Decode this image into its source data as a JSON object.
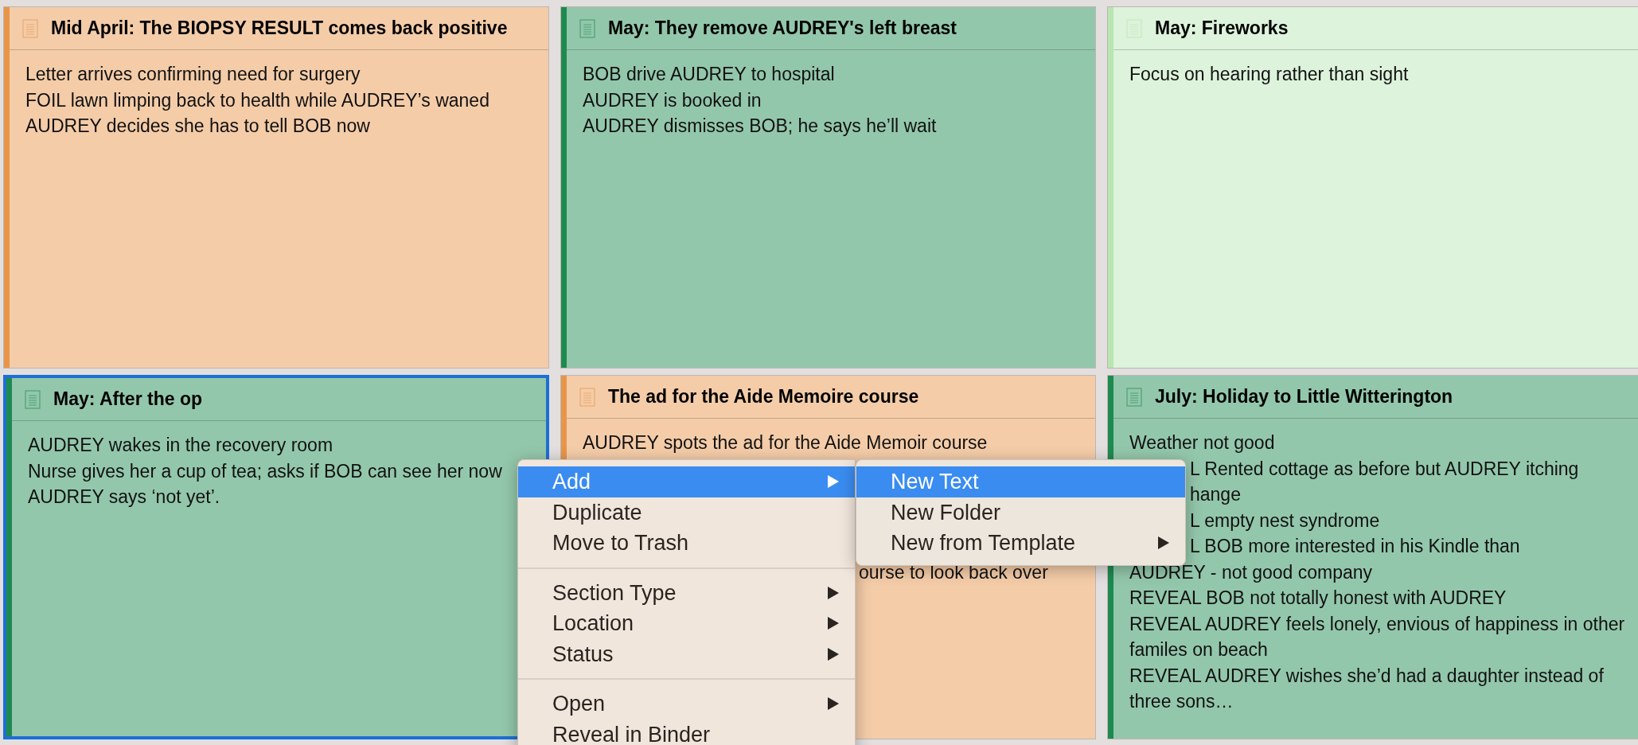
{
  "cards": [
    {
      "title": "Mid April: The BIOPSY RESULT comes back positive",
      "color": "#e8954a",
      "selected": false,
      "lines": [
        {
          "text": "Letter arrives confirming need for surgery",
          "kind": "full"
        },
        {
          "text": "FOIL lawn limping back to health while AUDREY’s waned",
          "kind": "full"
        },
        {
          "text": "AUDREY decides she has to tell BOB now",
          "kind": "full"
        }
      ]
    },
    {
      "title": "May: They remove AUDREY's left breast",
      "color": "#1e8a50",
      "selected": false,
      "lines": [
        {
          "text": "BOB drive AUDREY to hospital",
          "kind": "full"
        },
        {
          "text": "AUDREY is booked in",
          "kind": "full"
        },
        {
          "text": "AUDREY dismisses BOB; he says he’ll wait",
          "kind": "full"
        }
      ]
    },
    {
      "title": "May: Fireworks",
      "color": "#b9e5b3",
      "selected": false,
      "lines": [
        {
          "text": "Focus on hearing rather than sight",
          "kind": "full"
        }
      ]
    },
    {
      "title": "May: After the op",
      "color": "#1e8a50",
      "selected": true,
      "lines": [
        {
          "text": "AUDREY wakes in the recovery room",
          "kind": "full"
        },
        {
          "text": "Nurse gives her a cup of tea; asks if BOB can see her now",
          "kind": "full"
        },
        {
          "text": "AUDREY says ‘not yet’.",
          "kind": "full"
        }
      ]
    },
    {
      "title": "The ad for the Aide Memoire course",
      "color": "#e8954a",
      "selected": false,
      "lines": [
        {
          "text": "AUDREY spots the ad for the Aide Memoir course",
          "kind": "full"
        },
        {
          "text": "ourse to look back over",
          "kind": "behind_menu"
        }
      ]
    },
    {
      "title": "July: Holiday to Little Witterington",
      "color": "#1e8a50",
      "selected": false,
      "lines": [
        {
          "text": "Weather not good",
          "kind": "full"
        },
        {
          "text": "L Rented cottage as before but AUDREY itching",
          "kind": "behind_submenu"
        },
        {
          "text": "hange",
          "kind": "behind_submenu"
        },
        {
          "text": "L empty nest syndrome",
          "kind": "behind_submenu"
        },
        {
          "text": "L BOB more interested in his Kindle than",
          "kind": "behind_submenu"
        },
        {
          "text": "AUDREY - not good company",
          "kind": "full"
        },
        {
          "text": "REVEAL BOB not totally honest with AUDREY",
          "kind": "full"
        },
        {
          "text": "REVEAL AUDREY feels lonely, envious of happiness in other familes on beach",
          "kind": "full"
        },
        {
          "text": "REVEAL AUDREY wishes she’d had a daughter instead of three sons…",
          "kind": "full"
        }
      ]
    }
  ],
  "context_menu": {
    "items": [
      {
        "kind": "item",
        "label": "Add",
        "selected": true,
        "submenu": true
      },
      {
        "kind": "item",
        "label": "Duplicate",
        "selected": false,
        "submenu": false
      },
      {
        "kind": "item",
        "label": "Move to Trash",
        "selected": false,
        "submenu": false
      },
      {
        "kind": "separator"
      },
      {
        "kind": "item",
        "label": "Section Type",
        "selected": false,
        "submenu": true
      },
      {
        "kind": "item",
        "label": "Location",
        "selected": false,
        "submenu": true
      },
      {
        "kind": "item",
        "label": "Status",
        "selected": false,
        "submenu": true
      },
      {
        "kind": "separator"
      },
      {
        "kind": "item",
        "label": "Open",
        "selected": false,
        "submenu": true
      },
      {
        "kind": "item",
        "label": "Reveal in Binder",
        "selected": false,
        "submenu": false
      }
    ]
  },
  "submenu": {
    "items": [
      {
        "kind": "item",
        "label": "New Text",
        "selected": true,
        "submenu": false
      },
      {
        "kind": "item",
        "label": "New Folder",
        "selected": false,
        "submenu": false
      },
      {
        "kind": "item",
        "label": "New from Template",
        "selected": false,
        "submenu": true
      }
    ]
  }
}
